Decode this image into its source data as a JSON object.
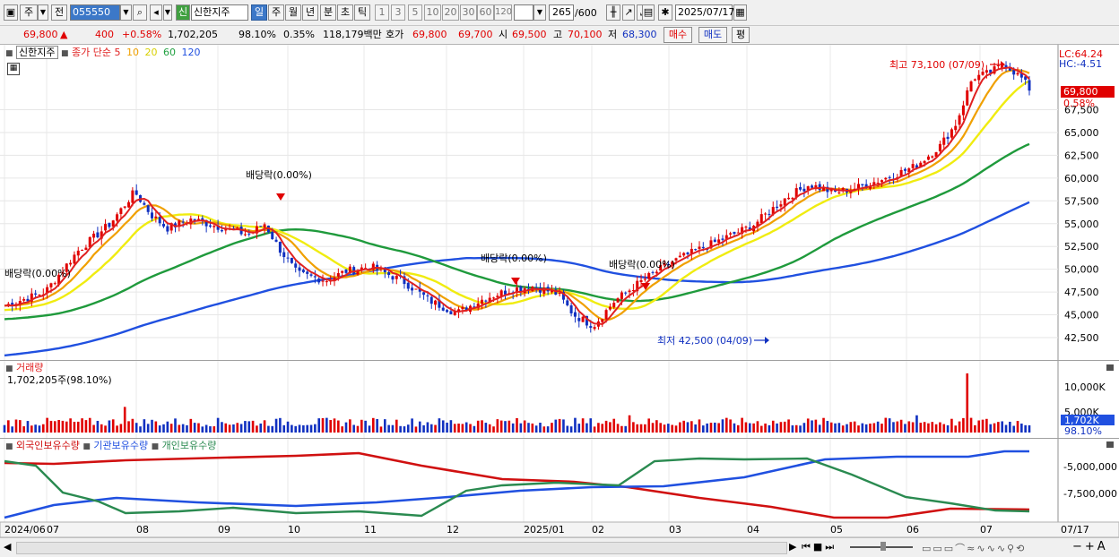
{
  "toolbar": {
    "period_jo": "주",
    "prev_label": "전",
    "code": "055550",
    "stock_name": "신한지주",
    "badge_shin": "신",
    "periods": [
      "일",
      "주",
      "월",
      "년",
      "분",
      "초",
      "틱"
    ],
    "active_period": "일",
    "intervals": [
      "1",
      "3",
      "5",
      "10",
      "20",
      "30",
      "60",
      "120"
    ],
    "count": "265",
    "count_max": "/600",
    "date": "2025/07/17"
  },
  "quote": {
    "price": "69,800",
    "change": "400",
    "change_pct": "+0.58%",
    "volume": "1,702,205",
    "vol_ratio": "98.10%",
    "turnover": "0.35%",
    "amount": "118,179백만",
    "hoga_label": "호가",
    "ask": "69,800",
    "bid": "69,700",
    "open_label": "시",
    "open": "69,500",
    "high_label": "고",
    "high": "70,100",
    "low_label": "저",
    "low": "68,300",
    "buy_label": "매수",
    "sell_label": "매도",
    "eval_label": "평"
  },
  "price_panel": {
    "legend_name": "신한지주",
    "legend_main": "종가 단순",
    "ma_labels": [
      {
        "text": "5",
        "color": "#e02020"
      },
      {
        "text": "10",
        "color": "#f0a000"
      },
      {
        "text": "20",
        "color": "#e8e000"
      },
      {
        "text": "60",
        "color": "#20a040"
      },
      {
        "text": "120",
        "color": "#2050e0"
      }
    ],
    "lc": "LC:64.24",
    "hc": "HC:-4.51",
    "current_price_tag": "69,800",
    "current_pct_tag": "0.58%",
    "y_ticks": [
      "67,500",
      "65,000",
      "62,500",
      "60,000",
      "57,500",
      "55,000",
      "52,500",
      "50,000",
      "47,500",
      "45,000",
      "42,500"
    ],
    "high_note": "최고 73,100 (07/09)",
    "low_note": "최저 42,500 (04/09)",
    "dividend_notes": [
      "배당락(0.00%)",
      "배당락(0.00%)",
      "배당락(0.00%)",
      "배당락(0.00%)"
    ]
  },
  "volume_panel": {
    "title": "거래량",
    "value": "1,702,205주(98.10%)",
    "y_ticks": [
      "10,000K",
      "5,000K"
    ],
    "current_tag": "1,702K",
    "current_pct": "98.10%"
  },
  "holdings_panel": {
    "series": [
      {
        "name": "외국인보유수량",
        "color": "#d01010"
      },
      {
        "name": "기관보유수량",
        "color": "#2050e0"
      },
      {
        "name": "개인보유수량",
        "color": "#2a8a50"
      }
    ],
    "y_ticks": [
      "-5,000,000",
      "-7,500,000"
    ]
  },
  "x_axis": [
    "2024/06",
    "07",
    "08",
    "09",
    "10",
    "11",
    "12",
    "2025/01",
    "02",
    "03",
    "04",
    "05",
    "06",
    "07",
    "07/17"
  ],
  "colors": {
    "up": "#e00000",
    "down": "#1030c0",
    "accent": "#3c78c8"
  }
}
